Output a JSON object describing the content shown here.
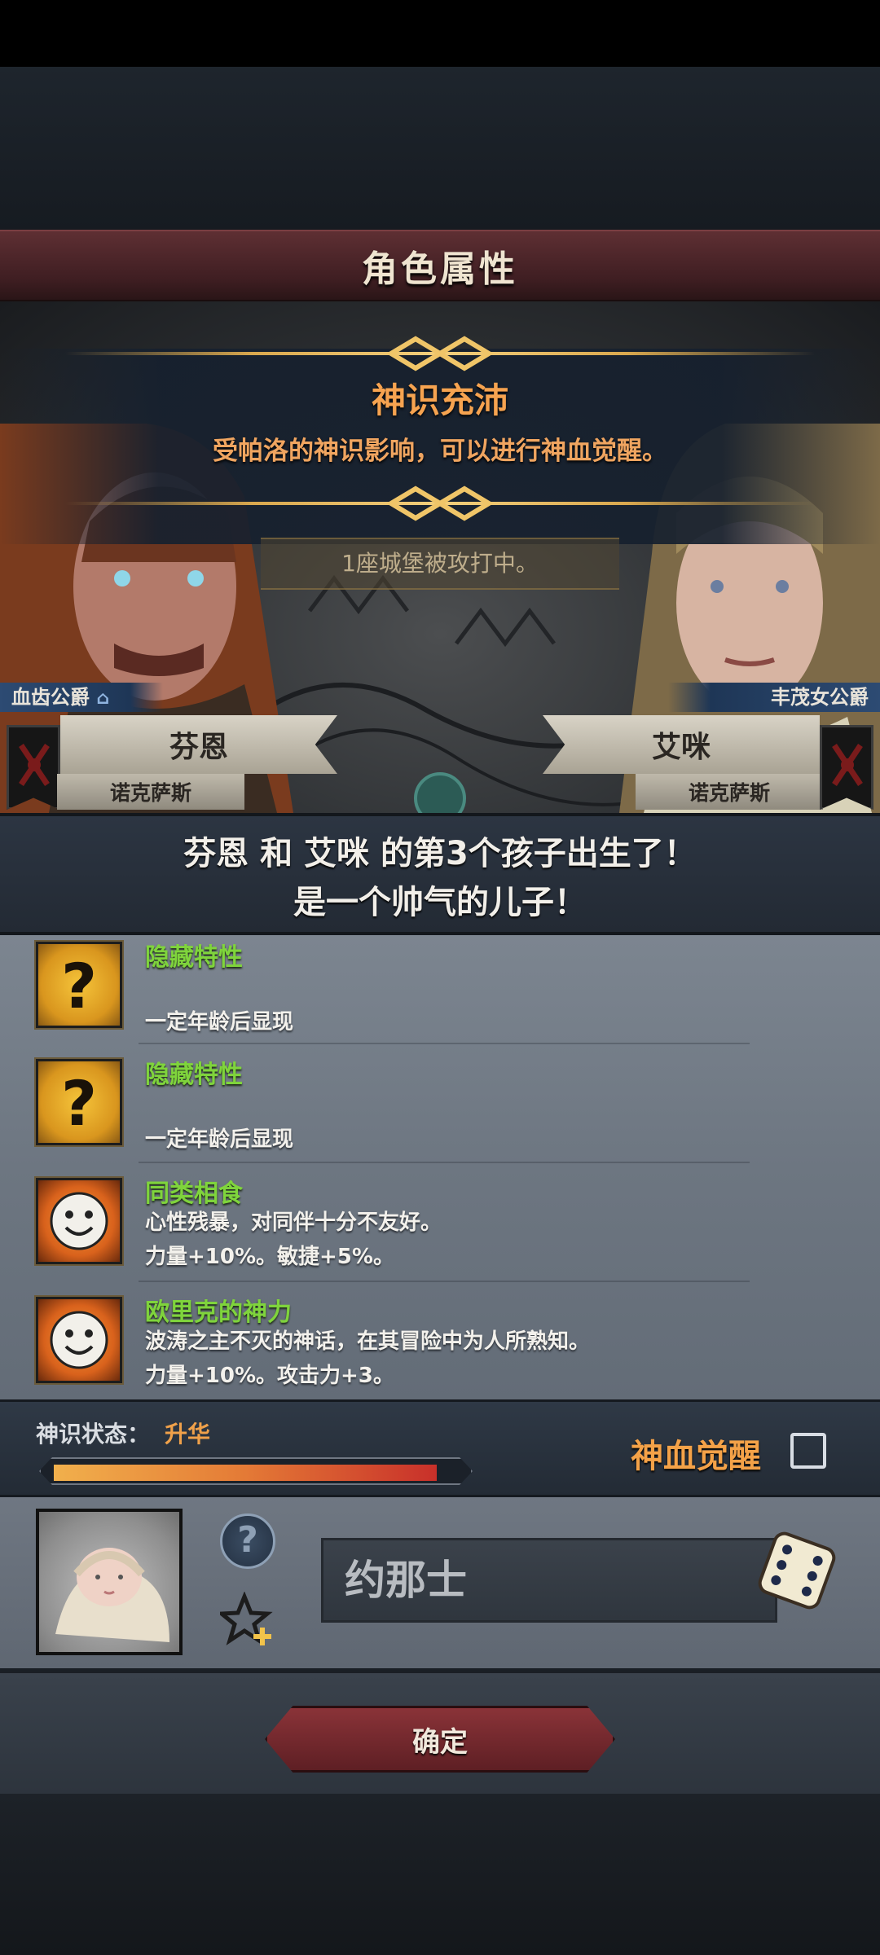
{
  "header": {
    "title": "角色属性"
  },
  "banner": {
    "title": "神识充沛",
    "description": "受帕洛的神识影响，可以进行神血觉醒。",
    "castle_message": "1座城堡被攻打中。"
  },
  "parents": {
    "father": {
      "title": "血齿公爵",
      "name": "芬恩",
      "house": "诺克萨斯"
    },
    "mother": {
      "title": "丰茂女公爵",
      "name": "艾咪",
      "house": "诺克萨斯"
    }
  },
  "birth": {
    "line1": "芬恩 和 艾咪 的第3个孩子出生了！",
    "line2": "是一个帅气的儿子！"
  },
  "traits": [
    {
      "name": "隐藏特性",
      "desc1": "",
      "desc2": "一定年龄后显现",
      "icon": "question-icon"
    },
    {
      "name": "隐藏特性",
      "desc1": "",
      "desc2": "一定年龄后显现",
      "icon": "question-icon"
    },
    {
      "name": "同类相食",
      "desc1": "心性残暴，对同伴十分不友好。",
      "desc2": "力量+10%。敏捷+5%。",
      "icon": "smiley-face-icon"
    },
    {
      "name": "欧里克的神力",
      "desc1": "波涛之主不灭的神话，在其冒险中为人所熟知。",
      "desc2": "力量+10%。攻击力+3。",
      "icon": "smiley-face-icon"
    }
  ],
  "divine": {
    "label": "神识状态：",
    "status": "升华",
    "progress": 0.96,
    "awaken_label": "神血觉醒",
    "awaken_checked": false
  },
  "child": {
    "name": "约那士"
  },
  "footer": {
    "confirm_label": "确定"
  },
  "colors": {
    "accent_orange": "#f4a248",
    "trait_green": "#7fd43c",
    "title_red": "#5e2f33"
  }
}
